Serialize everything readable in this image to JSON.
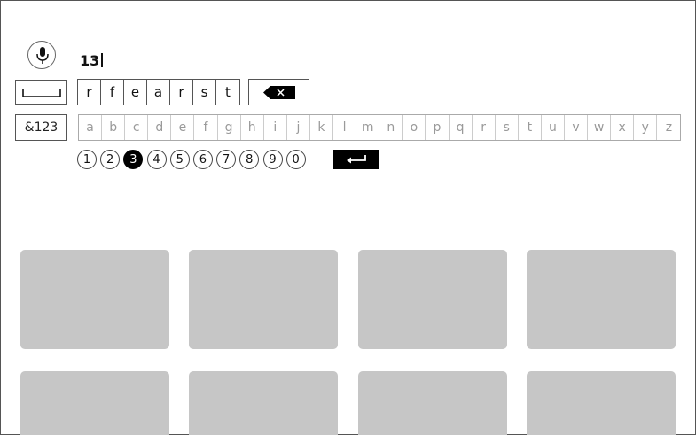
{
  "input": {
    "typed_text": "13"
  },
  "keyboard": {
    "suggestion_keys": [
      "r",
      "f",
      "e",
      "a",
      "r",
      "s",
      "t"
    ],
    "symbols_label": "&123",
    "alphabet": [
      "a",
      "b",
      "c",
      "d",
      "e",
      "f",
      "g",
      "h",
      "i",
      "j",
      "k",
      "l",
      "m",
      "n",
      "o",
      "p",
      "q",
      "r",
      "s",
      "t",
      "u",
      "v",
      "w",
      "x",
      "y",
      "z"
    ],
    "digits": [
      "1",
      "2",
      "3",
      "4",
      "5",
      "6",
      "7",
      "8",
      "9",
      "0"
    ],
    "selected_digit_index": 2
  },
  "tiles": {
    "count": 8,
    "color": "#c6c6c6"
  }
}
